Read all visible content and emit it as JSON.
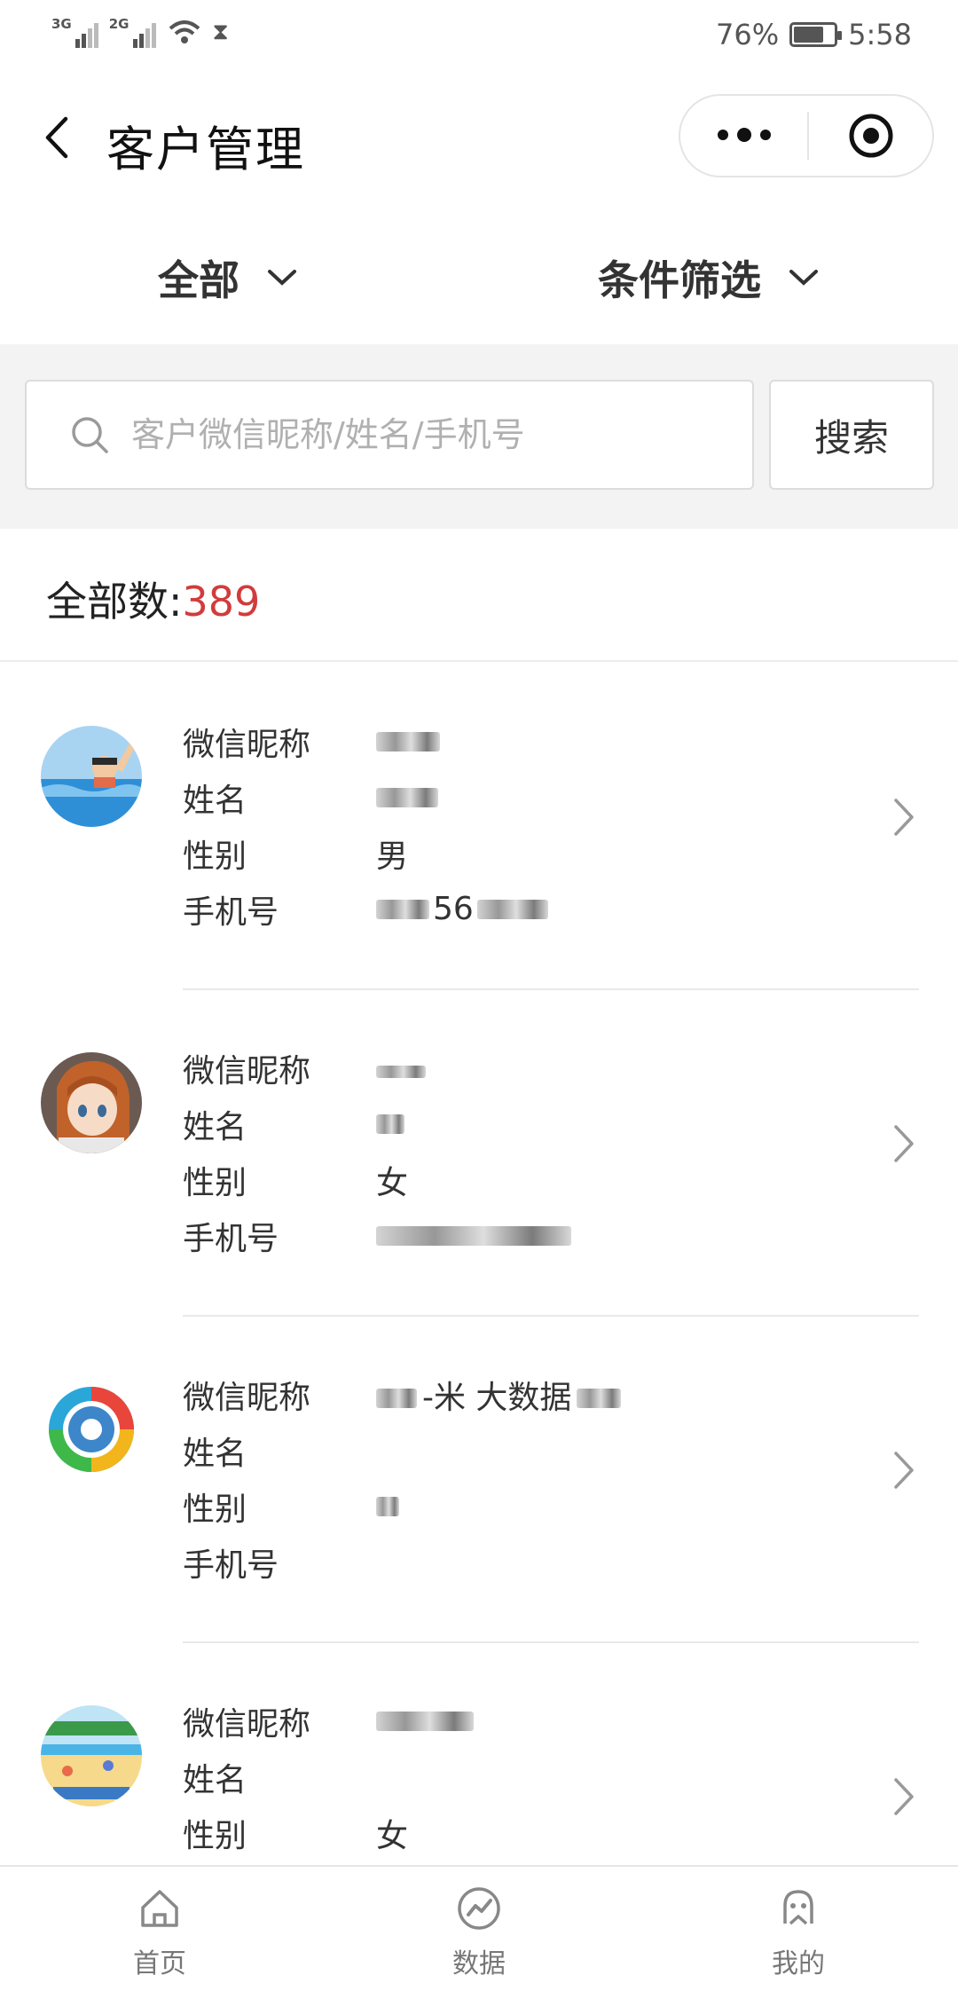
{
  "status_bar": {
    "signal1": "3G",
    "signal2": "2G",
    "battery_pct": "76%",
    "battery_level": 0.76,
    "time": "5:58",
    "icons": [
      "signal-icon",
      "wifi-icon",
      "hourglass-icon",
      "battery-icon"
    ]
  },
  "nav": {
    "title": "客户管理",
    "icons": [
      "back-arrow-icon",
      "more-dots-icon",
      "target-icon"
    ]
  },
  "filters": {
    "all_label": "全部",
    "condition_label": "条件筛选"
  },
  "search": {
    "placeholder": "客户微信昵称/姓名/手机号",
    "button_label": "搜索"
  },
  "total": {
    "label": "全部数:",
    "count": "389"
  },
  "field_labels": {
    "wechat": "微信昵称",
    "name": "姓名",
    "gender": "性别",
    "phone": "手机号"
  },
  "customers": [
    {
      "gender": "男",
      "phone_visible": "56"
    },
    {
      "gender": "女"
    },
    {
      "wechat_visible": "-米 大数据"
    },
    {
      "gender": "女"
    }
  ],
  "tabs": [
    {
      "label": "首页",
      "icon": "home-icon"
    },
    {
      "label": "数据",
      "icon": "data-chart-icon"
    },
    {
      "label": "我的",
      "icon": "profile-icon"
    }
  ],
  "colors": {
    "accent_red": "#d23b3b",
    "search_bg": "#f3f3f3",
    "divider": "#e9e9e9"
  }
}
